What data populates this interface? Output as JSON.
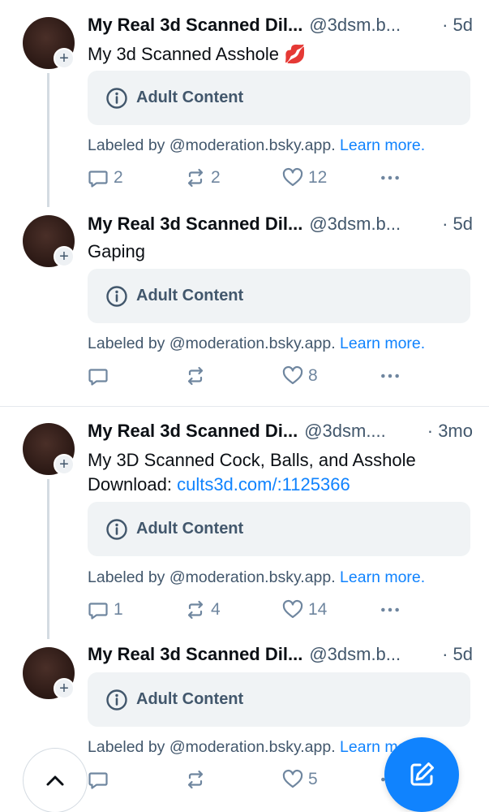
{
  "posts": [
    {
      "author": "My Real 3d Scanned Dil...",
      "handle": "@3dsm.b...",
      "time": "· 5d",
      "text": "My 3d Scanned Asshole 💋",
      "text_link": "",
      "content_label": "Adult Content",
      "labeled_by": "Labeled by @moderation.bsky.app.",
      "learn_more": "Learn more.",
      "replies": "2",
      "reposts": "2",
      "likes": "12"
    },
    {
      "author": "My Real 3d Scanned Dil...",
      "handle": "@3dsm.b...",
      "time": "· 5d",
      "text": "Gaping",
      "text_link": "",
      "content_label": "Adult Content",
      "labeled_by": "Labeled by @moderation.bsky.app.",
      "learn_more": "Learn more.",
      "replies": "",
      "reposts": "",
      "likes": "8"
    },
    {
      "author": "My Real 3d Scanned Di...",
      "handle": "@3dsm....",
      "time": "· 3mo",
      "text": "My 3D Scanned Cock, Balls, and Asshole Download: ",
      "text_link": "cults3d.com/:1125366",
      "content_label": "Adult Content",
      "labeled_by": "Labeled by @moderation.bsky.app.",
      "learn_more": "Learn more.",
      "replies": "1",
      "reposts": "4",
      "likes": "14"
    },
    {
      "author": "My Real 3d Scanned Dil...",
      "handle": "@3dsm.b...",
      "time": "· 5d",
      "text": "",
      "text_link": "",
      "content_label": "Adult Content",
      "labeled_by": "Labeled by @moderation.bsky.app.",
      "learn_more": "Learn more.",
      "replies": "",
      "reposts": "",
      "likes": "5"
    }
  ],
  "icons": {
    "follow": "plus-icon",
    "info": "info-icon",
    "reply": "reply-bubble-icon",
    "repost": "repost-icon",
    "like": "heart-icon",
    "more": "more-dots-icon",
    "scroll_top": "chevron-up-icon",
    "compose": "compose-icon"
  },
  "colors": {
    "accent": "#1083fe",
    "muted_text": "#42576c",
    "action_icon": "#6f869f",
    "label_box": "#f0f3f5",
    "thread_line": "#d4dbe2"
  }
}
